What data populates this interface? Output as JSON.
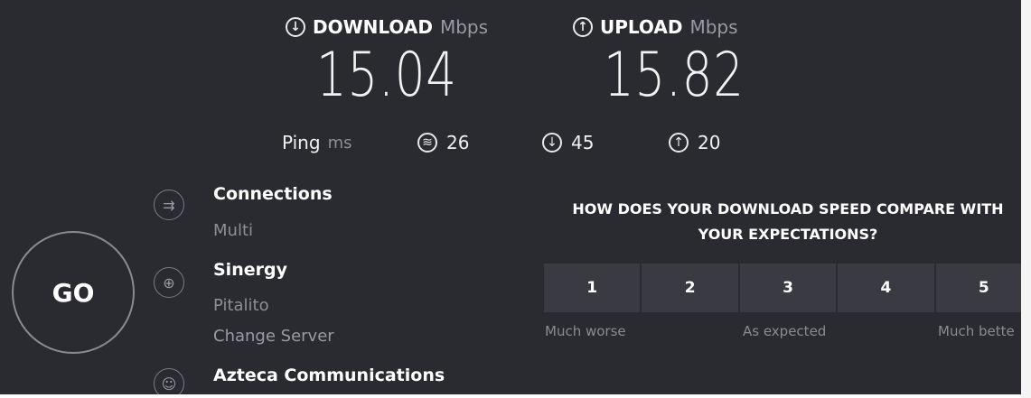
{
  "download": {
    "label": "DOWNLOAD",
    "unit": "Mbps",
    "value": "15.04",
    "icon": "arrow-down-circle-icon"
  },
  "upload": {
    "label": "UPLOAD",
    "unit": "Mbps",
    "value": "15.82",
    "icon": "arrow-up-circle-icon"
  },
  "ping": {
    "label": "Ping",
    "unit": "ms",
    "idle": {
      "icon": "idle-latency-icon",
      "value": "26"
    },
    "down": {
      "icon": "arrow-down-circle-icon",
      "value": "45"
    },
    "up": {
      "icon": "arrow-up-circle-icon",
      "value": "20"
    }
  },
  "go_button": {
    "label": "GO"
  },
  "connections": {
    "title": "Connections",
    "value": "Multi",
    "icon": "connections-icon"
  },
  "server": {
    "title": "Sinergy",
    "location": "Pitalito",
    "change_link": "Change Server",
    "icon": "globe-icon"
  },
  "provider": {
    "title": "Azteca Communications",
    "icon": "user-icon"
  },
  "survey": {
    "question_line1": "HOW DOES YOUR DOWNLOAD SPEED COMPARE WITH",
    "question_line2": "YOUR EXPECTATIONS?",
    "ratings": [
      "1",
      "2",
      "3",
      "4",
      "5"
    ],
    "label_low": "Much worse",
    "label_mid": "As expected",
    "label_high": "Much bette"
  },
  "colors": {
    "background": "#2a2a31",
    "text": "#ffffff",
    "muted": "#8e8e98",
    "rating_bg": "#3a3a42"
  }
}
